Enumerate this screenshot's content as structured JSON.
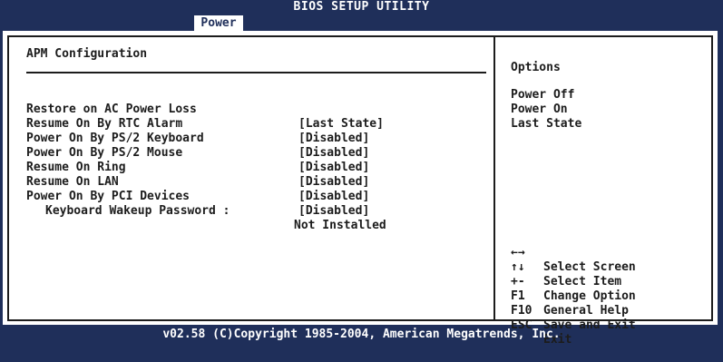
{
  "header": {
    "title": "BIOS SETUP UTILITY",
    "active_tab": "Power"
  },
  "main": {
    "section_title": "APM Configuration",
    "settings": [
      {
        "label": "Restore on AC Power Loss",
        "value": "[Last State]"
      },
      {
        "label": "Resume On By RTC Alarm",
        "value": "[Disabled]"
      },
      {
        "label": "Power On By PS/2 Keyboard",
        "value": "[Disabled]"
      },
      {
        "label": "Power On By PS/2 Mouse",
        "value": "[Disabled]"
      },
      {
        "label": "Resume On Ring",
        "value": "[Disabled]"
      },
      {
        "label": "Resume On LAN",
        "value": "[Disabled]"
      },
      {
        "label": "Power On By PCI Devices",
        "value": "[Disabled]"
      }
    ],
    "password": {
      "label": "Keyboard Wakeup Password :",
      "value": "Not Installed"
    }
  },
  "sidebar": {
    "title": "Options",
    "options": [
      "Power Off",
      "Power On",
      "Last State"
    ],
    "keys": [
      {
        "key": "←→",
        "desc": "Select Screen",
        "icon": "left-right-arrows-icon"
      },
      {
        "key": "↑↓",
        "desc": "Select Item",
        "icon": "up-down-arrows-icon"
      },
      {
        "key": "+-",
        "desc": "Change Option"
      },
      {
        "key": "F1",
        "desc": "General Help"
      },
      {
        "key": "F10",
        "desc": "Save and Exit"
      },
      {
        "key": "ESC",
        "desc": "Exit"
      }
    ]
  },
  "footer": {
    "text": "v02.58 (C)Copyright 1985-2004, American Megatrends, Inc."
  },
  "colors": {
    "background": "#1f2f5a",
    "panel": "#ffffff",
    "text": "#1c1c1c"
  }
}
